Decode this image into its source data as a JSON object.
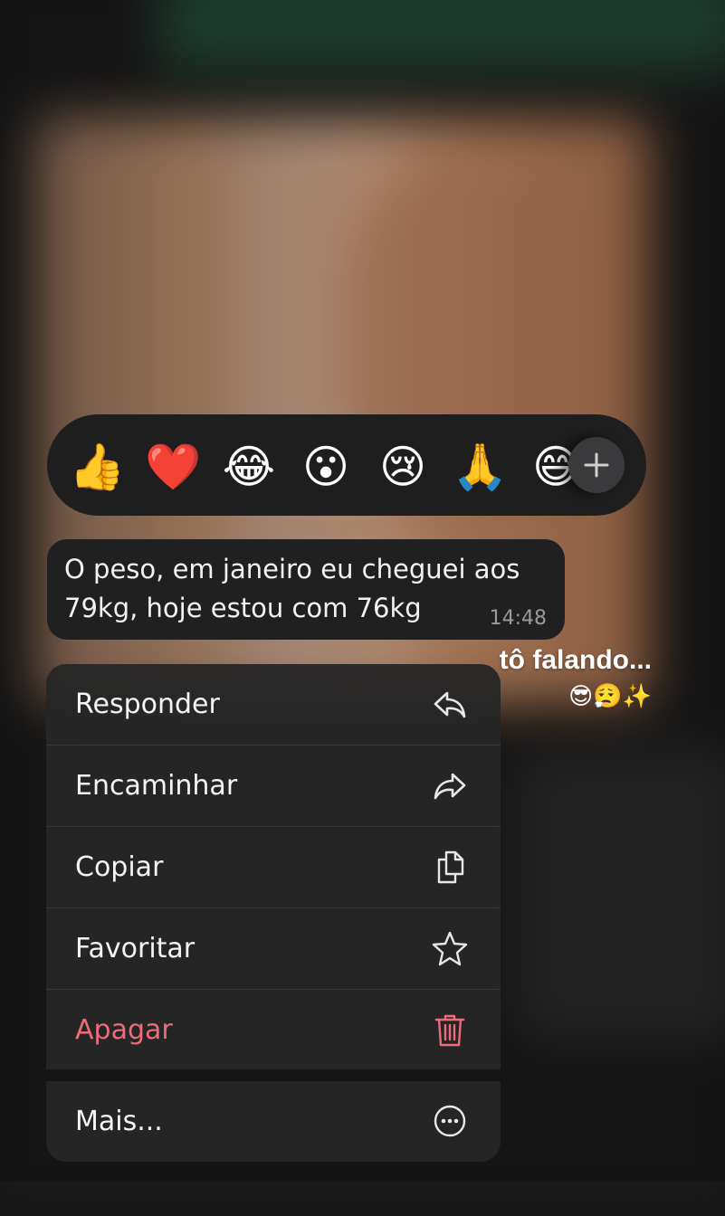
{
  "reactions": {
    "items": [
      {
        "emoji": "👍",
        "name": "thumbs-up"
      },
      {
        "emoji": "❤️",
        "name": "red-heart"
      },
      {
        "emoji": "😂",
        "name": "tears-of-joy"
      },
      {
        "emoji": "😮",
        "name": "open-mouth"
      },
      {
        "emoji": "😢",
        "name": "crying-face"
      },
      {
        "emoji": "🙏",
        "name": "folded-hands"
      },
      {
        "emoji": "😅",
        "name": "grinning-sweat"
      }
    ],
    "plus_icon": "plus-icon"
  },
  "message": {
    "text": "O peso, em janeiro eu cheguei aos\n79kg, hoje estou com 76kg",
    "time": "14:48"
  },
  "overlay": {
    "caption": "tô falando...",
    "emojis": "😎😮‍💨✨"
  },
  "menu": {
    "items": [
      {
        "label": "Responder",
        "icon": "reply-icon"
      },
      {
        "label": "Encaminhar",
        "icon": "forward-icon"
      },
      {
        "label": "Copiar",
        "icon": "copy-icon"
      },
      {
        "label": "Favoritar",
        "icon": "star-icon"
      },
      {
        "label": "Apagar",
        "icon": "trash-icon"
      }
    ],
    "more": {
      "label": "Mais...",
      "icon": "more-icon"
    },
    "danger_color": "#ee6b7a"
  }
}
